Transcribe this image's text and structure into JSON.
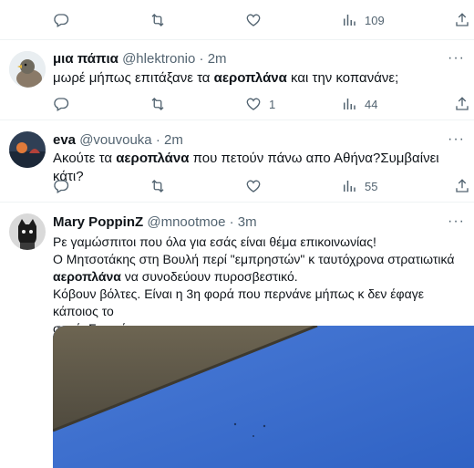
{
  "tweets": [
    {
      "id": "top",
      "actions": {
        "reply": "",
        "retweet": "",
        "like": "",
        "views": "109"
      }
    },
    {
      "id": "t1",
      "name": "μια πάπια",
      "handle": "@hlektronio",
      "dot": "·",
      "time": "2m",
      "text_parts": [
        "μωρέ μήπως επιτάξανε τα ",
        "αεροπλάνα",
        " και την κοπανάνε;"
      ],
      "actions": {
        "reply": "",
        "retweet": "",
        "like": "1",
        "views": "44"
      }
    },
    {
      "id": "t2",
      "name": "eva",
      "handle": "@vouvouka",
      "dot": "·",
      "time": "2m",
      "text_parts": [
        "Ακούτε τα ",
        "αεροπλάνα",
        " που πετούν πάνω απο Αθήνα?Συμβαίνει κάτι?"
      ],
      "actions": {
        "reply": "",
        "retweet": "",
        "like": "",
        "views": "55"
      }
    },
    {
      "id": "t3",
      "name": "Mary PoppinZ",
      "handle": "@mnootmoe",
      "dot": "·",
      "time": "3m",
      "lines": {
        "l1": "Ρε γαμώσπιτοι που όλα για εσάς είναι θέμα επικοινωνίας!",
        "l2": "Ο Μητσοτάκης στη Βουλή περί \"εμπρηστών\" κ ταυτόχρονα στρατιωτικά",
        "l3_bold": "αεροπλάνα",
        "l3_rest": " να συνοδεύουν πυροσβεστικό.",
        "l4": "Κόβουν βόλτες. Είναι η 3η φορά που περνάνε μήπως κ δεν έφαγε κάποιος το",
        "l5": "σανό. Σιχαμένοι γτχσ"
      }
    }
  ],
  "more_label": "···",
  "colors": {
    "text": "#0f1419",
    "secondary": "#536471",
    "divider": "#eff3f4",
    "sky": "#3f6fcf"
  },
  "icons": [
    "reply-icon",
    "retweet-icon",
    "like-icon",
    "views-icon",
    "share-icon",
    "more-icon"
  ]
}
